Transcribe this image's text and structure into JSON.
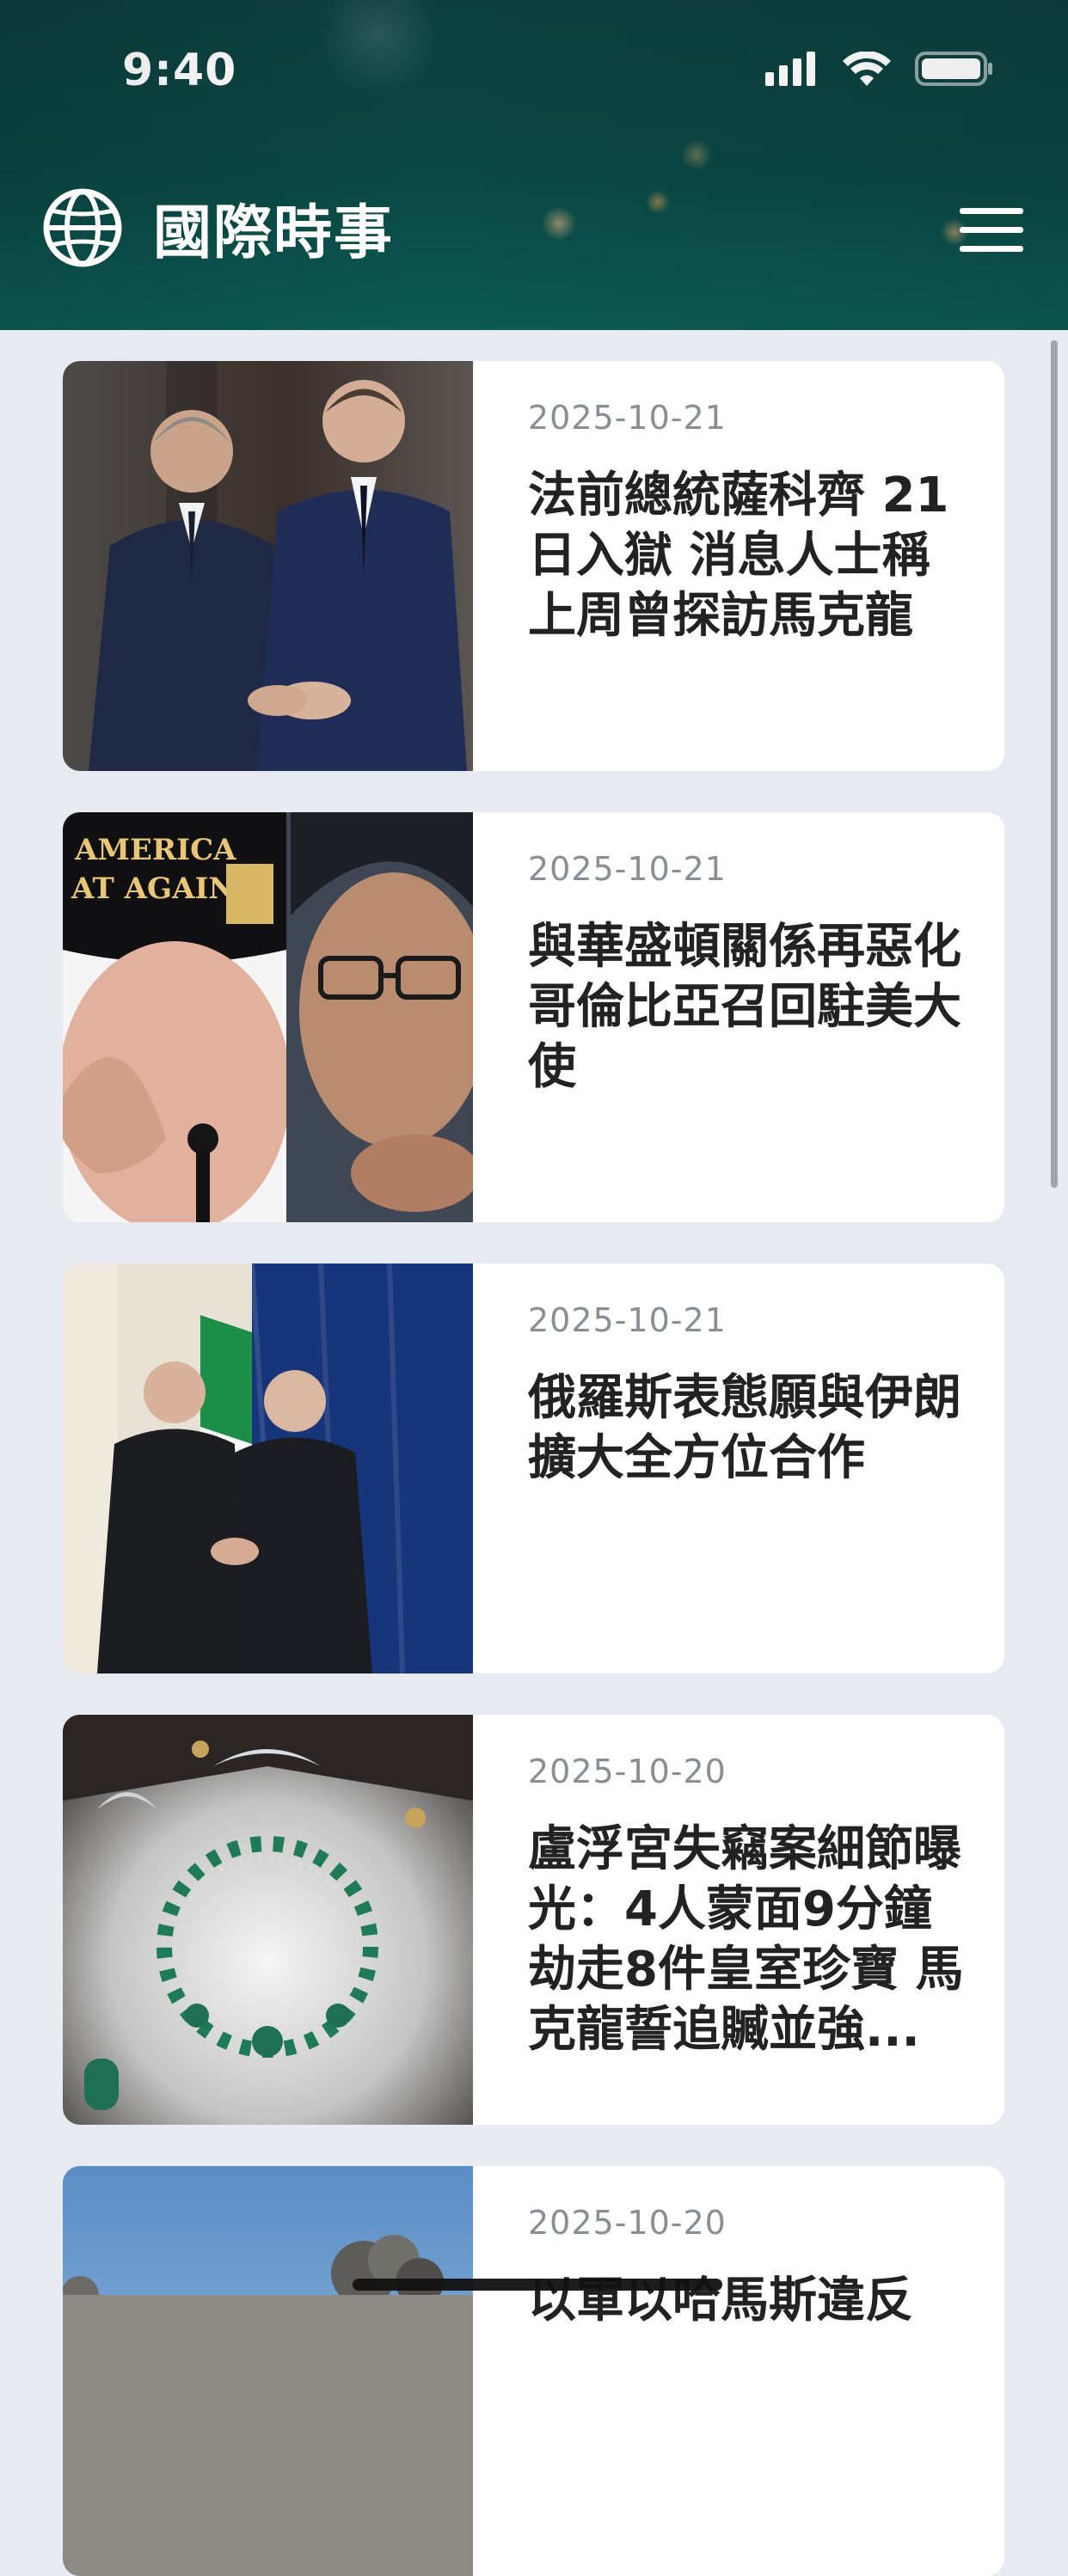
{
  "status_bar": {
    "time": "9:40",
    "icons": [
      "cellular-signal-icon",
      "wifi-icon",
      "battery-icon"
    ]
  },
  "header": {
    "logo_icon": "globe-icon",
    "title": "國際時事",
    "menu_icon": "hamburger-menu-icon"
  },
  "news": [
    {
      "date": "2025-10-21",
      "title": "法前總統薩科齊 21日入獄 消息人士稱上周曾探訪馬克龍"
    },
    {
      "date": "2025-10-21",
      "title": "與華盛頓關係再惡化 哥倫比亞召回駐美大使"
    },
    {
      "date": "2025-10-21",
      "title": "俄羅斯表態願與伊朗擴大全方位合作"
    },
    {
      "date": "2025-10-20",
      "title": "盧浮宮失竊案細節曝光：4人蒙面9分鐘劫走8件皇室珍寶 馬克龍誓追贓並強..."
    },
    {
      "date": "2025-10-20",
      "title": "以軍以哈馬斯違反"
    }
  ],
  "thumb_texts": {
    "hat_text_line1": "AMERICA",
    "hat_text_line2": "AT AGAIN"
  },
  "colors": {
    "header_bg": "#0a4844",
    "page_bg": "#e8eaf2",
    "card_bg": "#ffffff",
    "date_text": "#8a8d94",
    "title_text": "#222222"
  }
}
